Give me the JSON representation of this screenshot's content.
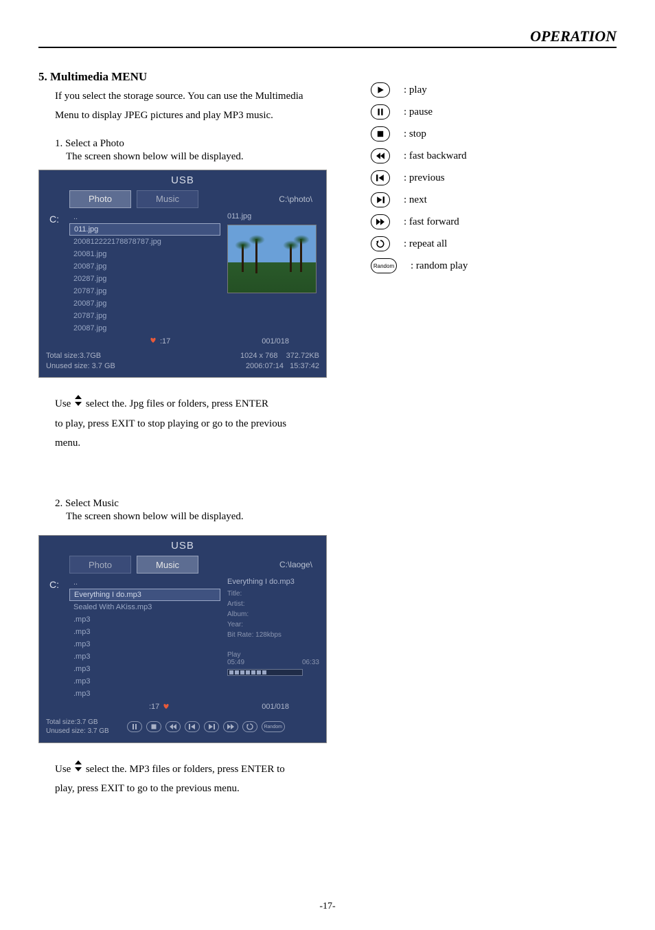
{
  "header": "OPERATION",
  "section": {
    "number": "5.",
    "title": "Multimedia  MENU"
  },
  "intro1": "If you select the storage source. You can use the Multimedia",
  "intro2": "Menu to display JPEG pictures and play MP3 music.",
  "step1": {
    "num": "1.",
    "label": "Select a Photo",
    "sub": "The screen shown below will be displayed."
  },
  "panel1": {
    "title": "USB",
    "drive": "C:",
    "tabs": {
      "photo": "Photo",
      "music": "Music"
    },
    "path": "C:\\photo\\",
    "files": {
      "updir": "..",
      "sel": "011.jpg",
      "rest": [
        "200812222178878787.jpg",
        "20081.jpg",
        "20087.jpg",
        "20287.jpg",
        "20787.jpg",
        "20087.jpg",
        "20787.jpg",
        "20087.jpg"
      ]
    },
    "preview_name": "011.jpg",
    "count_icon": ":17",
    "count_pos": "001/018",
    "total": "Total size:3.7GB",
    "unused": "Unused size: 3.7 GB",
    "dim": "1024 x 768",
    "filesize": "372.72KB",
    "date": "2006:07:14",
    "time": "15:37:42"
  },
  "instr1a": "Use ",
  "instr1b": " select the. Jpg files or folders, press ENTER",
  "instr1c": "to play, press EXIT to stop playing or go to the previous",
  "instr1d": "menu.",
  "step2": {
    "num": "2.",
    "label": "Select Music",
    "sub": "The screen shown below will be displayed."
  },
  "panel2": {
    "title": "USB",
    "drive": "C:",
    "tabs": {
      "photo": "Photo",
      "music": "Music"
    },
    "path": "C:\\laoge\\",
    "files": {
      "updir": "..",
      "sel": "Everything I do.mp3",
      "rest": [
        "Sealed With AKiss.mp3",
        ".mp3",
        ".mp3",
        ".mp3",
        ".mp3",
        ".mp3",
        ".mp3",
        ".mp3"
      ]
    },
    "info_file": "Everything I do.mp3",
    "info_title": "Title:",
    "info_artist": "Artist:",
    "info_album": "Album:",
    "info_year": "Year:",
    "info_bitrate": "Bit Rate: 128kbps",
    "play_label": "Play",
    "cur": "05:49",
    "total_t": "06:33",
    "count_icon": ":17",
    "count_pos": "001/018",
    "total": "Total size:3.7 GB",
    "unused": "Unused size: 3.7 GB",
    "random": "Random"
  },
  "instr2a": "Use ",
  "instr2b": " select the. MP3 files or folders, press ENTER to",
  "instr2c": "play, press EXIT to go to the previous menu.",
  "legend": {
    "play": ": play",
    "pause": ": pause",
    "stop": ": stop",
    "fb": ": fast backward",
    "prev": ": previous",
    "next": ": next",
    "ff": ": fast forward",
    "repeat": ": repeat all",
    "random_label": "Random",
    "random": ": random play"
  },
  "page_num": "-17-"
}
